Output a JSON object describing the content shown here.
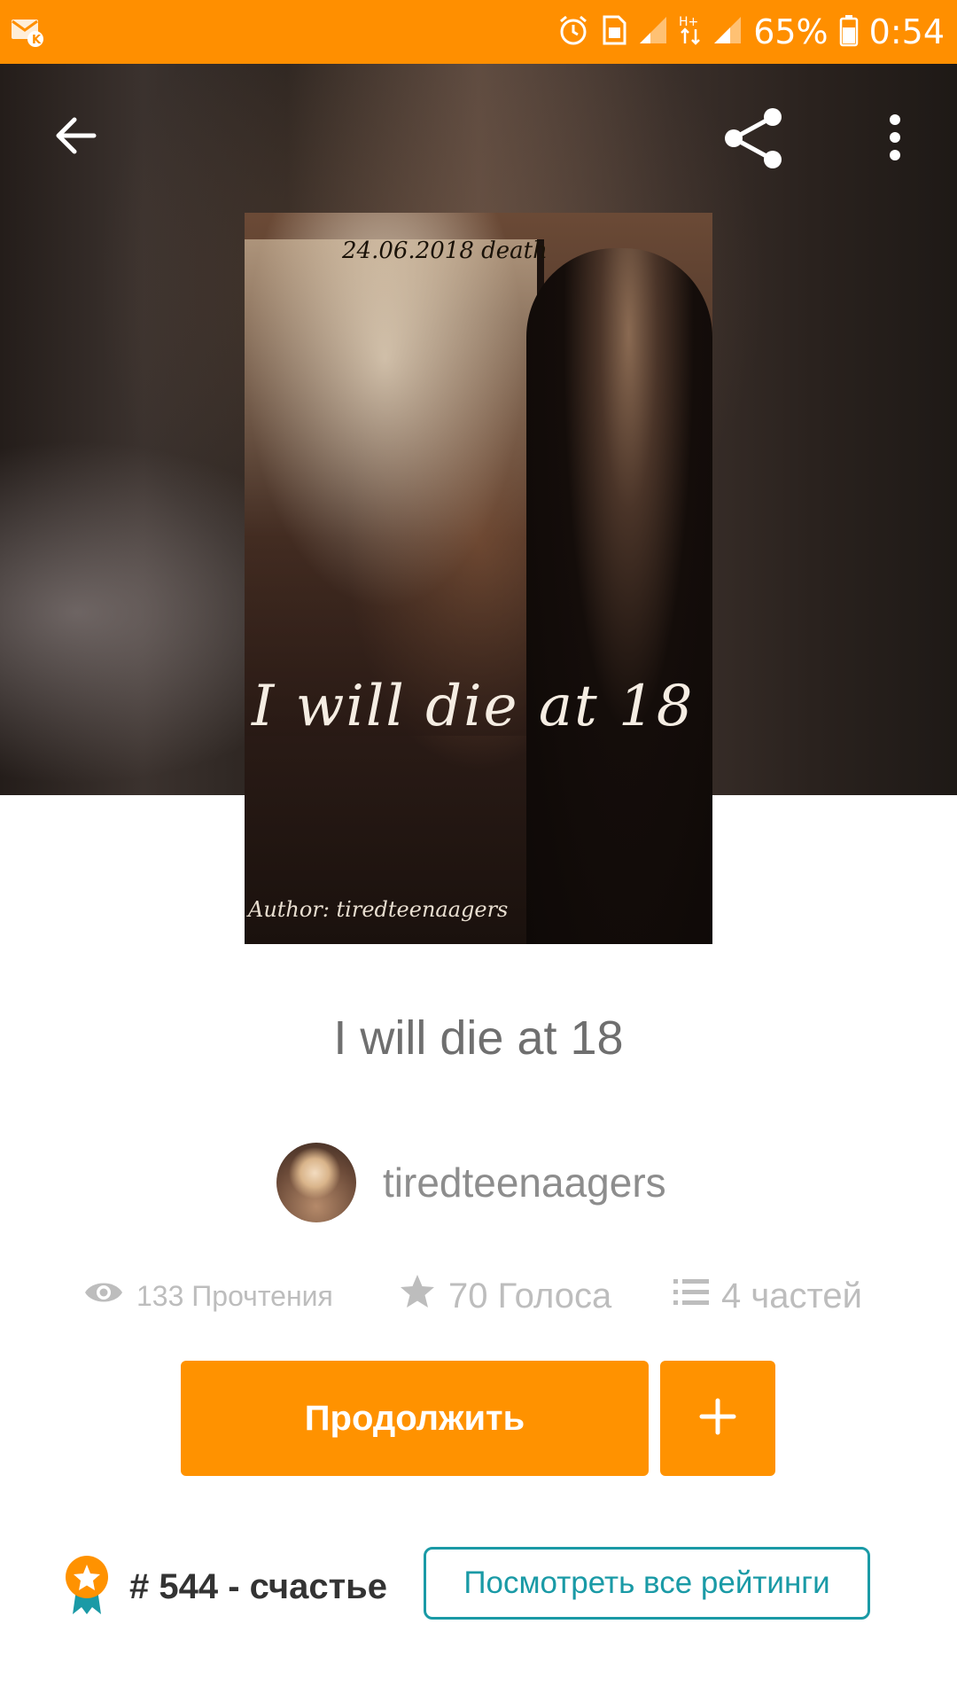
{
  "status_bar": {
    "battery_percent": "65%",
    "time": "0:54",
    "color": "#ff8f00"
  },
  "toolbar": {
    "back_icon": "arrow-left-icon",
    "share_icon": "share-icon",
    "more_icon": "more-vertical-icon"
  },
  "cover": {
    "top_text": "24.06.2018 death",
    "title_text": "I will die at 18",
    "author_text": "Author: tiredteenaagers"
  },
  "story": {
    "title": "I will die at 18",
    "author": "tiredteenaagers"
  },
  "stats": {
    "reads": "133 Прочтения",
    "votes": "70 Голоса",
    "parts": "4 частей"
  },
  "actions": {
    "continue_label": "Продолжить",
    "add_label": "+",
    "accent": "#ff9200"
  },
  "ranking": {
    "rank_text": "# 544 - счастье",
    "view_all_label": "Посмотреть все рейтинги",
    "link_color": "#1a9aa6"
  }
}
